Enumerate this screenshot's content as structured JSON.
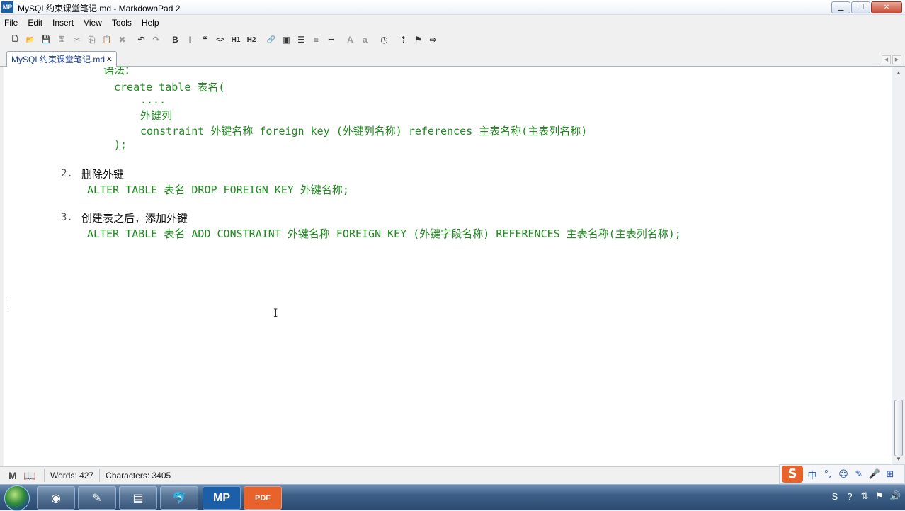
{
  "window": {
    "app_icon": "MP",
    "title": "MySQL约束课堂笔记.md - MarkdownPad 2",
    "controls": [
      "minimize",
      "maximize",
      "close"
    ]
  },
  "menu": [
    "File",
    "Edit",
    "Insert",
    "View",
    "Tools",
    "Help"
  ],
  "toolbar": {
    "buttons": [
      {
        "name": "new-icon",
        "glyph": "🗋"
      },
      {
        "name": "open-icon",
        "glyph": "📂"
      },
      {
        "name": "save-icon",
        "glyph": "💾",
        "dim": true
      },
      {
        "name": "save-all-icon",
        "glyph": "🖫",
        "dim": true
      },
      {
        "name": "cut-icon",
        "glyph": "✂",
        "dim": true
      },
      {
        "name": "copy-icon",
        "glyph": "⎘",
        "dim": true
      },
      {
        "name": "paste-icon",
        "glyph": "📋"
      },
      {
        "name": "delete-icon",
        "glyph": "✖",
        "dim": true
      },
      {
        "name": "undo-icon",
        "glyph": "↶"
      },
      {
        "name": "redo-icon",
        "glyph": "↷",
        "dim": true
      },
      {
        "name": "bold-icon",
        "glyph": "B"
      },
      {
        "name": "italic-icon",
        "glyph": "I"
      },
      {
        "name": "quote-icon",
        "glyph": "❝"
      },
      {
        "name": "code-icon",
        "glyph": "<>"
      },
      {
        "name": "h1-icon",
        "glyph": "H1"
      },
      {
        "name": "h2-icon",
        "glyph": "H2"
      },
      {
        "name": "link-icon",
        "glyph": "🔗"
      },
      {
        "name": "image-icon",
        "glyph": "▣"
      },
      {
        "name": "unordered-list-icon",
        "glyph": "☰"
      },
      {
        "name": "ordered-list-icon",
        "glyph": "≡"
      },
      {
        "name": "horizontal-rule-icon",
        "glyph": "━"
      },
      {
        "name": "font-increase-icon",
        "glyph": "A",
        "dim": true
      },
      {
        "name": "font-decrease-icon",
        "glyph": "a",
        "dim": true
      },
      {
        "name": "timestamp-icon",
        "glyph": "◷"
      },
      {
        "name": "upload-icon",
        "glyph": "⇡"
      },
      {
        "name": "preview-icon",
        "glyph": "⚑"
      },
      {
        "name": "export-icon",
        "glyph": "⇨"
      }
    ]
  },
  "tab": {
    "label": "MySQL约束课堂笔记.md",
    "close": "✕"
  },
  "editor": {
    "lines": [
      {
        "indent": "code",
        "text": "语法：",
        "partial": true
      },
      {
        "indent": "code",
        "text": "create table 表名("
      },
      {
        "indent": "code2",
        "text": "...."
      },
      {
        "indent": "code2",
        "text": "外键列"
      },
      {
        "indent": "code2",
        "text": "constraint 外键名称 foreign key (外键列名称) references 主表名称(主表列名称)"
      },
      {
        "indent": "code",
        "text": ");"
      }
    ],
    "item2": {
      "number": "2.",
      "heading": "删除外键",
      "code": "ALTER TABLE 表名 DROP FOREIGN KEY 外键名称;"
    },
    "item3": {
      "number": "3.",
      "heading": "创建表之后，添加外键",
      "code": "ALTER TABLE 表名 ADD CONSTRAINT 外键名称 FOREIGN KEY (外键字段名称) REFERENCES 主表名称(主表列名称);"
    }
  },
  "status": {
    "words": "Words: 427",
    "characters": "Characters: 3405"
  },
  "ime": {
    "items": [
      "中",
      "°,",
      "☺",
      "✎",
      "🎤",
      "⊞"
    ]
  },
  "taskbar": {
    "apps": [
      "browser",
      "paint",
      "explorer",
      "mysql",
      "markdownpad",
      "pdf"
    ],
    "active_app": "markdownpad",
    "markdownpad_label": "MP",
    "pdf_label": "PDF"
  }
}
